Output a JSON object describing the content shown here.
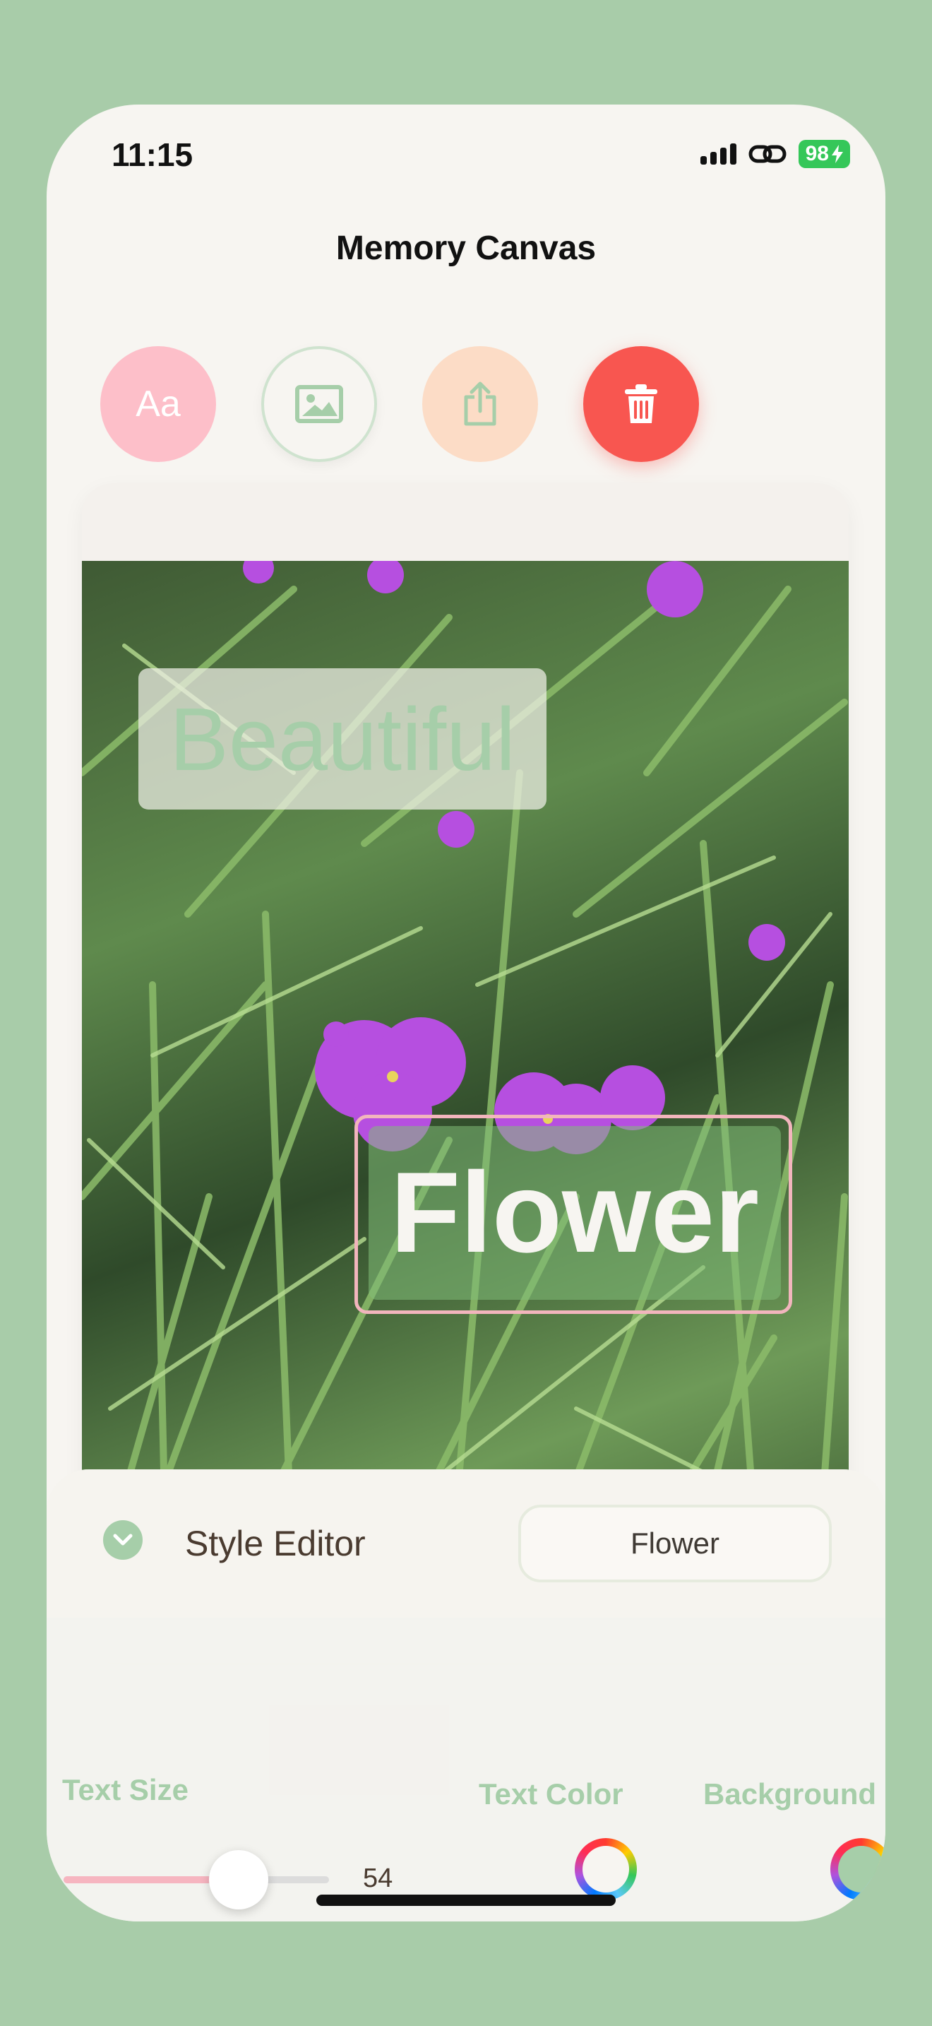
{
  "status_bar": {
    "time": "11:15",
    "battery": "98"
  },
  "header": {
    "title": "Memory Canvas"
  },
  "toolbar": {
    "text_button": "Aa",
    "image_icon": "photo-icon",
    "share_icon": "share-icon",
    "delete_icon": "trash-icon"
  },
  "canvas": {
    "overlays": [
      {
        "text": "Beautiful",
        "color": "#a6cea9"
      },
      {
        "text": "Flower",
        "color": "#f7f5f1",
        "selected": true
      }
    ]
  },
  "style_editor": {
    "title": "Style Editor",
    "selected_text": "Flower",
    "text_size_label": "Text Size",
    "text_size_value": "54",
    "text_size_fraction": 0.66,
    "text_color_label": "Text Color",
    "background_label": "Background",
    "text_color": "#f7f5f1",
    "background_color": "#a6cea9"
  },
  "colors": {
    "accent_green": "#a6cea9",
    "accent_pink": "#fdbfc9",
    "accent_peach": "#fcdcc6",
    "delete_red": "#f85650"
  }
}
